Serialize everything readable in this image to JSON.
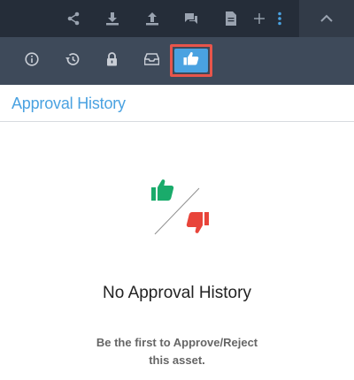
{
  "top_actions": {
    "icons": [
      "share-icon",
      "download-icon",
      "upload-icon",
      "comments-icon",
      "document-icon",
      "plus-icon",
      "more-vertical-icon"
    ],
    "collapse_icon": "chevron-up-icon"
  },
  "toolbar": {
    "tabs": [
      {
        "icon": "info-icon",
        "active": false
      },
      {
        "icon": "history-icon",
        "active": false
      },
      {
        "icon": "lock-icon",
        "active": false
      },
      {
        "icon": "inbox-icon",
        "active": false
      },
      {
        "icon": "thumbs-up-icon",
        "active": true
      }
    ]
  },
  "panel": {
    "title": "Approval History"
  },
  "empty_state": {
    "title": "No Approval History",
    "subtitle_line1": "Be the first to Approve/Reject",
    "subtitle_line2": "this asset."
  },
  "colors": {
    "accent": "#4aa2e1",
    "approve": "#1aab6b",
    "reject": "#e8443a",
    "highlight": "#e8554b"
  }
}
